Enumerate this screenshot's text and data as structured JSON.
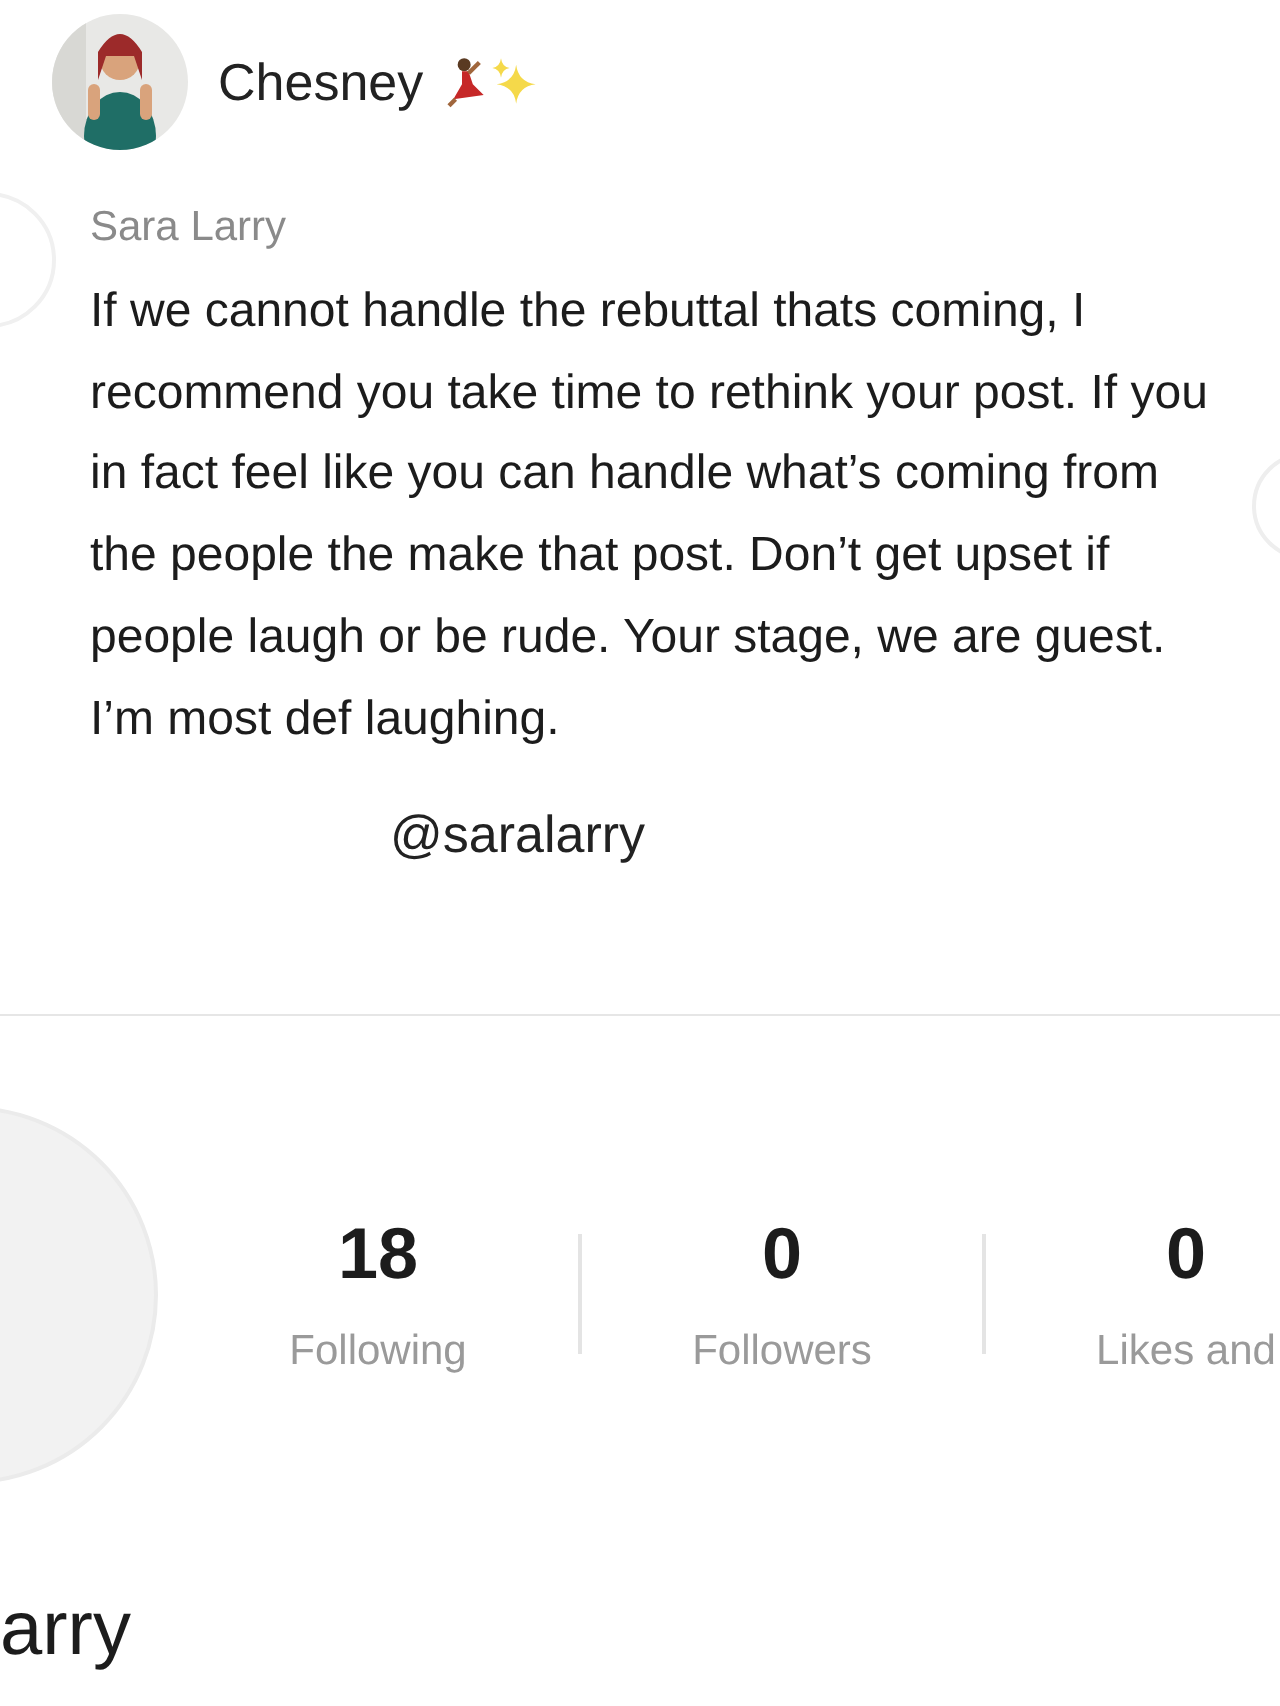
{
  "post": {
    "author": "Chesney"
  },
  "comment": {
    "author": "Sara Larry",
    "text": "If we cannot handle the rebuttal thats coming, I recommend you take time to rethink your post. If you in fact feel like you can handle what’s coming from the people the make that post. Don’t get upset if people laugh or be rude. Your stage, we are guest. I’m most def laughing.",
    "handle": "@saralarry"
  },
  "profile": {
    "stats": [
      {
        "value": "18",
        "label": "Following"
      },
      {
        "value": "0",
        "label": "Followers"
      },
      {
        "value": "0",
        "label": "Likes and"
      }
    ],
    "name": "arry"
  }
}
